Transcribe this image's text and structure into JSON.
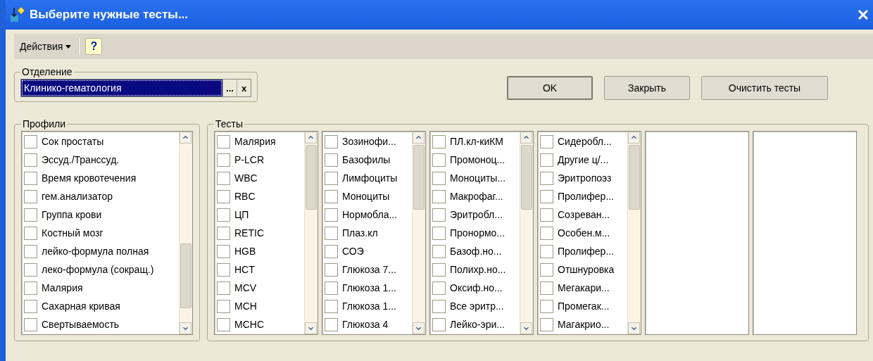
{
  "window": {
    "title": "Выберите нужные тесты..."
  },
  "toolbar": {
    "menu": "Действия",
    "help": "?"
  },
  "department": {
    "label": "Отделение",
    "value": "Клинико-гематология",
    "select_button": "...",
    "clear_button": "x"
  },
  "buttons": [
    {
      "label": "OK",
      "default": true
    },
    {
      "label": "Закрыть",
      "default": false
    },
    {
      "label": "Очистить тесты",
      "default": false
    }
  ],
  "profiles": {
    "label": "Профили",
    "items": [
      {
        "label": "Сок простаты",
        "checked": false
      },
      {
        "label": "Эссуд./Транссуд.",
        "checked": false
      },
      {
        "label": "Время кровотечения",
        "checked": false
      },
      {
        "label": "гем.анализатор",
        "checked": false
      },
      {
        "label": "Группа крови",
        "checked": false
      },
      {
        "label": "Костный мозг",
        "checked": false
      },
      {
        "label": "лейко-формула полная",
        "checked": false
      },
      {
        "label": "леко-формула (сокращ.)",
        "checked": false
      },
      {
        "label": "Малярия",
        "checked": false
      },
      {
        "label": "Сахарная кривая",
        "checked": false
      },
      {
        "label": "Свертываемость",
        "checked": false
      }
    ]
  },
  "tests": {
    "label": "Тесты",
    "lists": [
      {
        "kind": "list",
        "items": [
          {
            "label": "Малярия",
            "checked": false
          },
          {
            "label": "P-LCR",
            "checked": false
          },
          {
            "label": "WBC",
            "checked": false
          },
          {
            "label": "RBC",
            "checked": false
          },
          {
            "label": "ЦП",
            "checked": false
          },
          {
            "label": "RETIC",
            "checked": false
          },
          {
            "label": "HGB",
            "checked": false
          },
          {
            "label": "HCT",
            "checked": false
          },
          {
            "label": "MCV",
            "checked": false
          },
          {
            "label": "MCH",
            "checked": false
          },
          {
            "label": "MCHC",
            "checked": false
          }
        ]
      },
      {
        "kind": "list",
        "items": [
          {
            "label": "Зозинофи...",
            "checked": false
          },
          {
            "label": "Базофилы",
            "checked": false
          },
          {
            "label": "Лимфоциты",
            "checked": false
          },
          {
            "label": "Моноциты",
            "checked": false
          },
          {
            "label": "Нормобла...",
            "checked": false
          },
          {
            "label": "Плаз.кл",
            "checked": false
          },
          {
            "label": "СОЭ",
            "checked": false
          },
          {
            "label": "Глюкоза 7...",
            "checked": false
          },
          {
            "label": "Глюкоза 1...",
            "checked": false
          },
          {
            "label": "Глюкоза 1...",
            "checked": false
          },
          {
            "label": "Глюкоза 4",
            "checked": false
          }
        ]
      },
      {
        "kind": "list",
        "items": [
          {
            "label": "ПЛ.кл-киКМ",
            "checked": false
          },
          {
            "label": "Промоноц...",
            "checked": false
          },
          {
            "label": "Моноциты...",
            "checked": false
          },
          {
            "label": "Макрофаг...",
            "checked": false
          },
          {
            "label": "Эритробл...",
            "checked": false
          },
          {
            "label": "Пронормо...",
            "checked": false
          },
          {
            "label": "Базоф.но...",
            "checked": false
          },
          {
            "label": "Полихр.но...",
            "checked": false
          },
          {
            "label": "Оксиф.но...",
            "checked": false
          },
          {
            "label": "Все эритр...",
            "checked": false
          },
          {
            "label": "Лейко-эри...",
            "checked": false
          }
        ]
      },
      {
        "kind": "list",
        "items": [
          {
            "label": "Сидеробл...",
            "checked": false
          },
          {
            "label": "Другие ц/...",
            "checked": false
          },
          {
            "label": "Эритропоэз",
            "checked": false
          },
          {
            "label": "Пролифер...",
            "checked": false
          },
          {
            "label": "Созреван...",
            "checked": false
          },
          {
            "label": "Особен.м...",
            "checked": false
          },
          {
            "label": "Пролифер...",
            "checked": false
          },
          {
            "label": "Отшнуровка",
            "checked": false
          },
          {
            "label": "Мегакари...",
            "checked": false
          },
          {
            "label": "Промегак...",
            "checked": false
          },
          {
            "label": "Магакрио...",
            "checked": false
          }
        ]
      },
      {
        "kind": "empty"
      },
      {
        "kind": "empty"
      }
    ]
  }
}
